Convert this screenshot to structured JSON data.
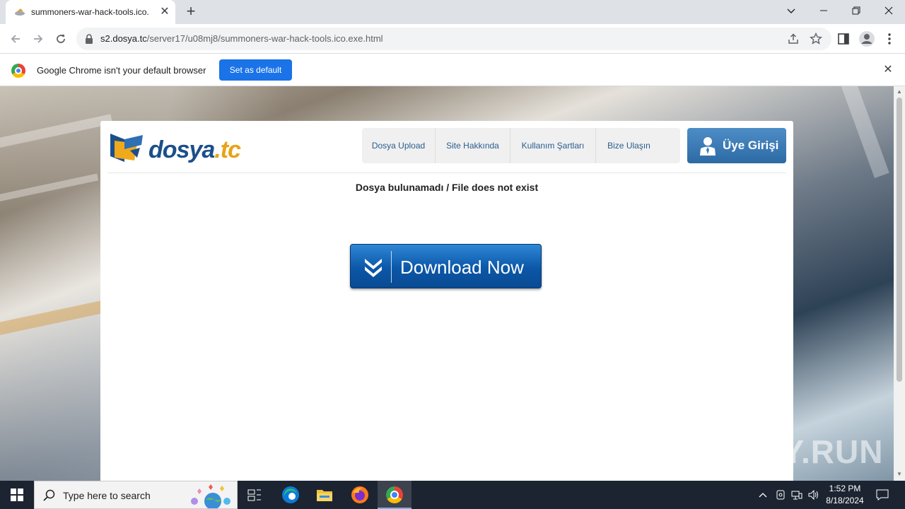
{
  "browser": {
    "tab_title": "summoners-war-hack-tools.ico.",
    "url_host": "s2.dosya.tc",
    "url_path": "/server17/u08mj8/summoners-war-hack-tools.ico.exe.html",
    "infobar_message": "Google Chrome isn't your default browser",
    "infobar_button": "Set as default",
    "new_tab_glyph": "+",
    "close_glyph": "✕"
  },
  "site": {
    "logo_name": "dosya",
    "logo_tld": ".tc",
    "nav": [
      "Dosya Upload",
      "Site Hakkında",
      "Kullanım Şartları",
      "Bize Ulaşın"
    ],
    "login_label": "Üye Girişi",
    "message": "Dosya bulunamadı / File does not exist",
    "download_label": "Download Now"
  },
  "watermark": "ANY.RUN",
  "taskbar": {
    "search_placeholder": "Type here to search",
    "time": "1:52 PM",
    "date": "8/18/2024",
    "apps": [
      "task-view",
      "edge",
      "file-explorer",
      "firefox",
      "chrome"
    ]
  },
  "colors": {
    "brand_blue": "#1b4f8a",
    "brand_orange": "#e8a317",
    "chrome_blue": "#1a73e8",
    "taskbar": "#1c2431"
  }
}
